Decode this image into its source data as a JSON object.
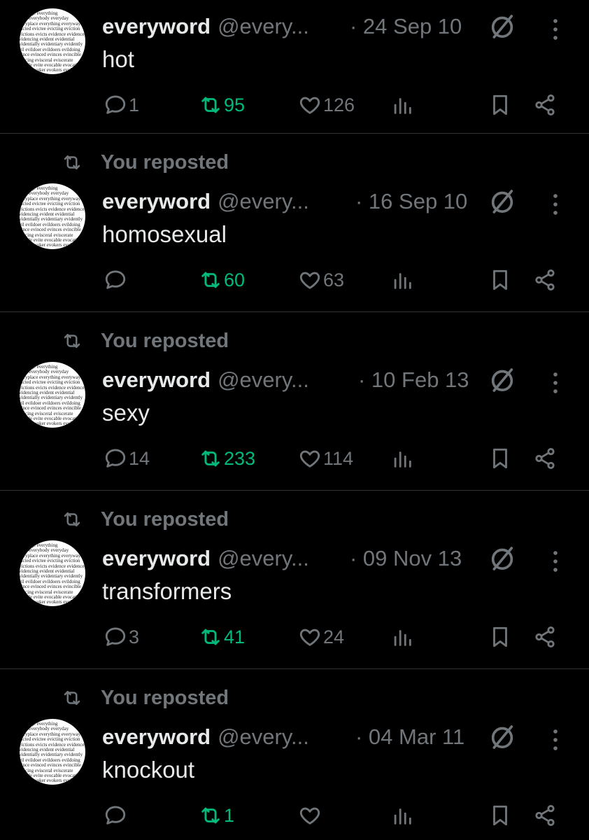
{
  "colors": {
    "background": "#000000",
    "text": "#e7e9ea",
    "muted": "#71767b",
    "repost_green": "#00ba7c",
    "divider": "#2f3336"
  },
  "repost_label": "You reposted",
  "avatar_words": [
    "challenge everything",
    "every everybody everyday",
    "everyplace everything everyway",
    "evicted evictee evicting eviction",
    "evictions evicts evidence evidenced",
    "evidencing evident evidential",
    "evidentially evidentiary evidently",
    "evil evildoer evildoers evildoing",
    "evince evinced evinces evincible",
    "evincing evisceral eviscerate",
    "evitable evite evocable evocation",
    "evoked evoker evokers evokes"
  ],
  "posts": [
    {
      "name": "everyword",
      "handle": "@every...",
      "date": "· 24 Sep 10",
      "text": "hot",
      "replies": "1",
      "reposts": "95",
      "likes": "126",
      "reposted": false
    },
    {
      "name": "everyword",
      "handle": "@every...",
      "date": "· 16 Sep 10",
      "text": "homosexual",
      "replies": "",
      "reposts": "60",
      "likes": "63",
      "reposted": true
    },
    {
      "name": "everyword",
      "handle": "@every...",
      "date": "· 10 Feb 13",
      "text": "sexy",
      "replies": "14",
      "reposts": "233",
      "likes": "114",
      "reposted": true
    },
    {
      "name": "everyword",
      "handle": "@every...",
      "date": "· 09 Nov 13",
      "text": "transformers",
      "replies": "3",
      "reposts": "41",
      "likes": "24",
      "reposted": true
    },
    {
      "name": "everyword",
      "handle": "@every...",
      "date": "· 04 Mar 11",
      "text": "knockout",
      "replies": "",
      "reposts": "1",
      "likes": "",
      "reposted": true
    }
  ]
}
